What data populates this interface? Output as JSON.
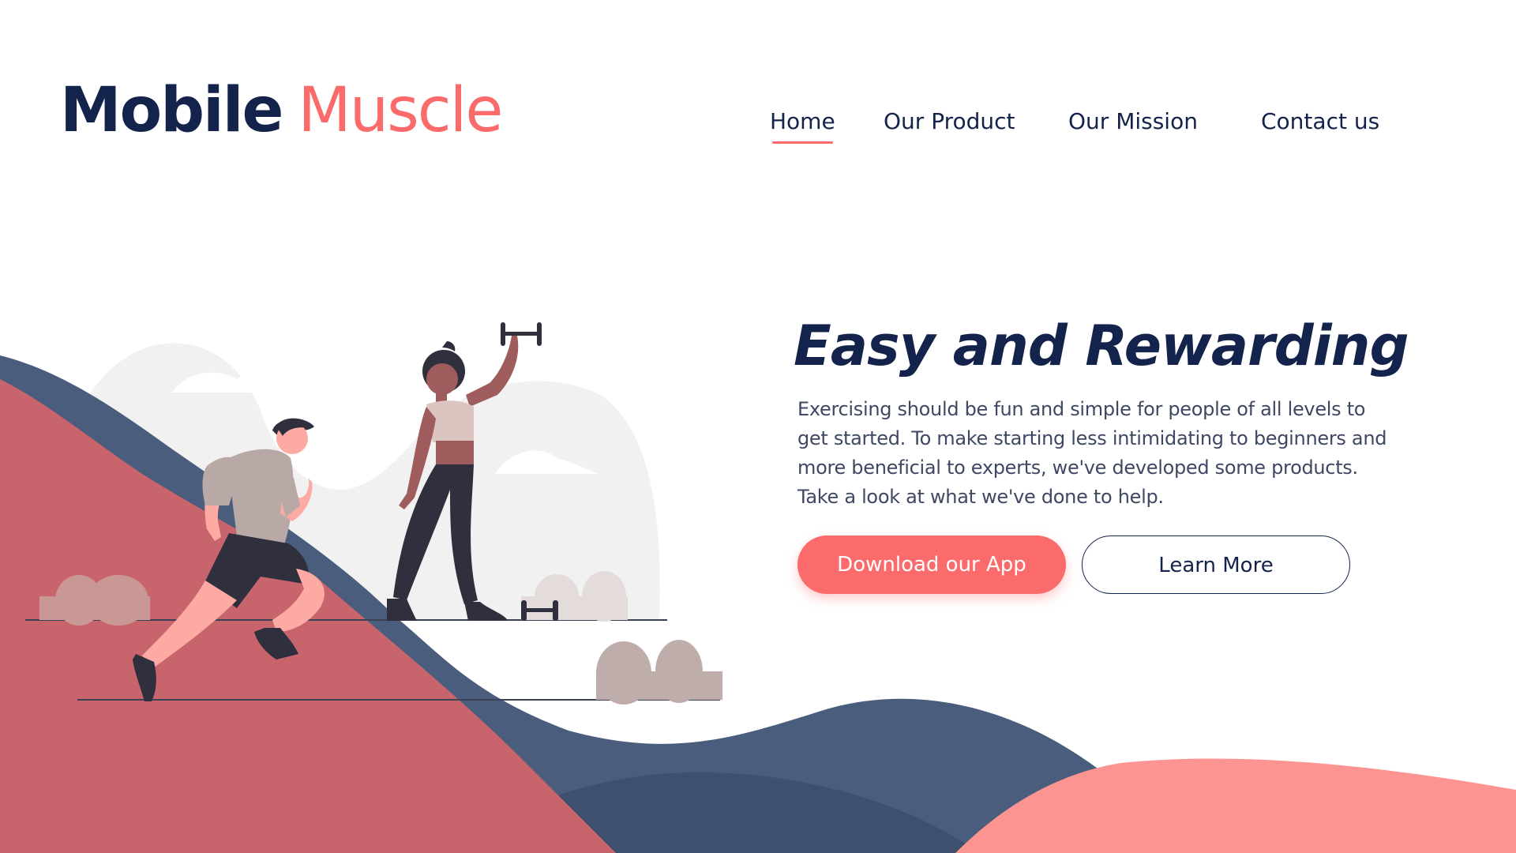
{
  "brand": {
    "name_part1": "Mobile",
    "name_part2": "Muscle"
  },
  "nav": {
    "items": [
      {
        "label": "Home",
        "active": true
      },
      {
        "label": "Our Product",
        "active": false
      },
      {
        "label": "Our Mission",
        "active": false
      },
      {
        "label": "Contact us",
        "active": false
      }
    ]
  },
  "hero": {
    "headline": "Easy and Rewarding",
    "description": "Exercising should be fun and simple for people of all levels to get started. To make starting less intimidating to beginners and more beneficial to experts, we've developed some products. Take a look at what we've done to help.",
    "primary_button": "Download our App",
    "secondary_button": "Learn More"
  },
  "colors": {
    "navy": "#14234b",
    "coral": "#fb6b6b",
    "hill_red": "#c8646c",
    "hill_blue": "#4a5d7c",
    "hill_pink": "#fc9592"
  },
  "illustration": {
    "subjects": [
      "running-man",
      "woman-lifting-dumbbell",
      "dumbbell",
      "bushes",
      "clouds",
      "hills"
    ]
  }
}
